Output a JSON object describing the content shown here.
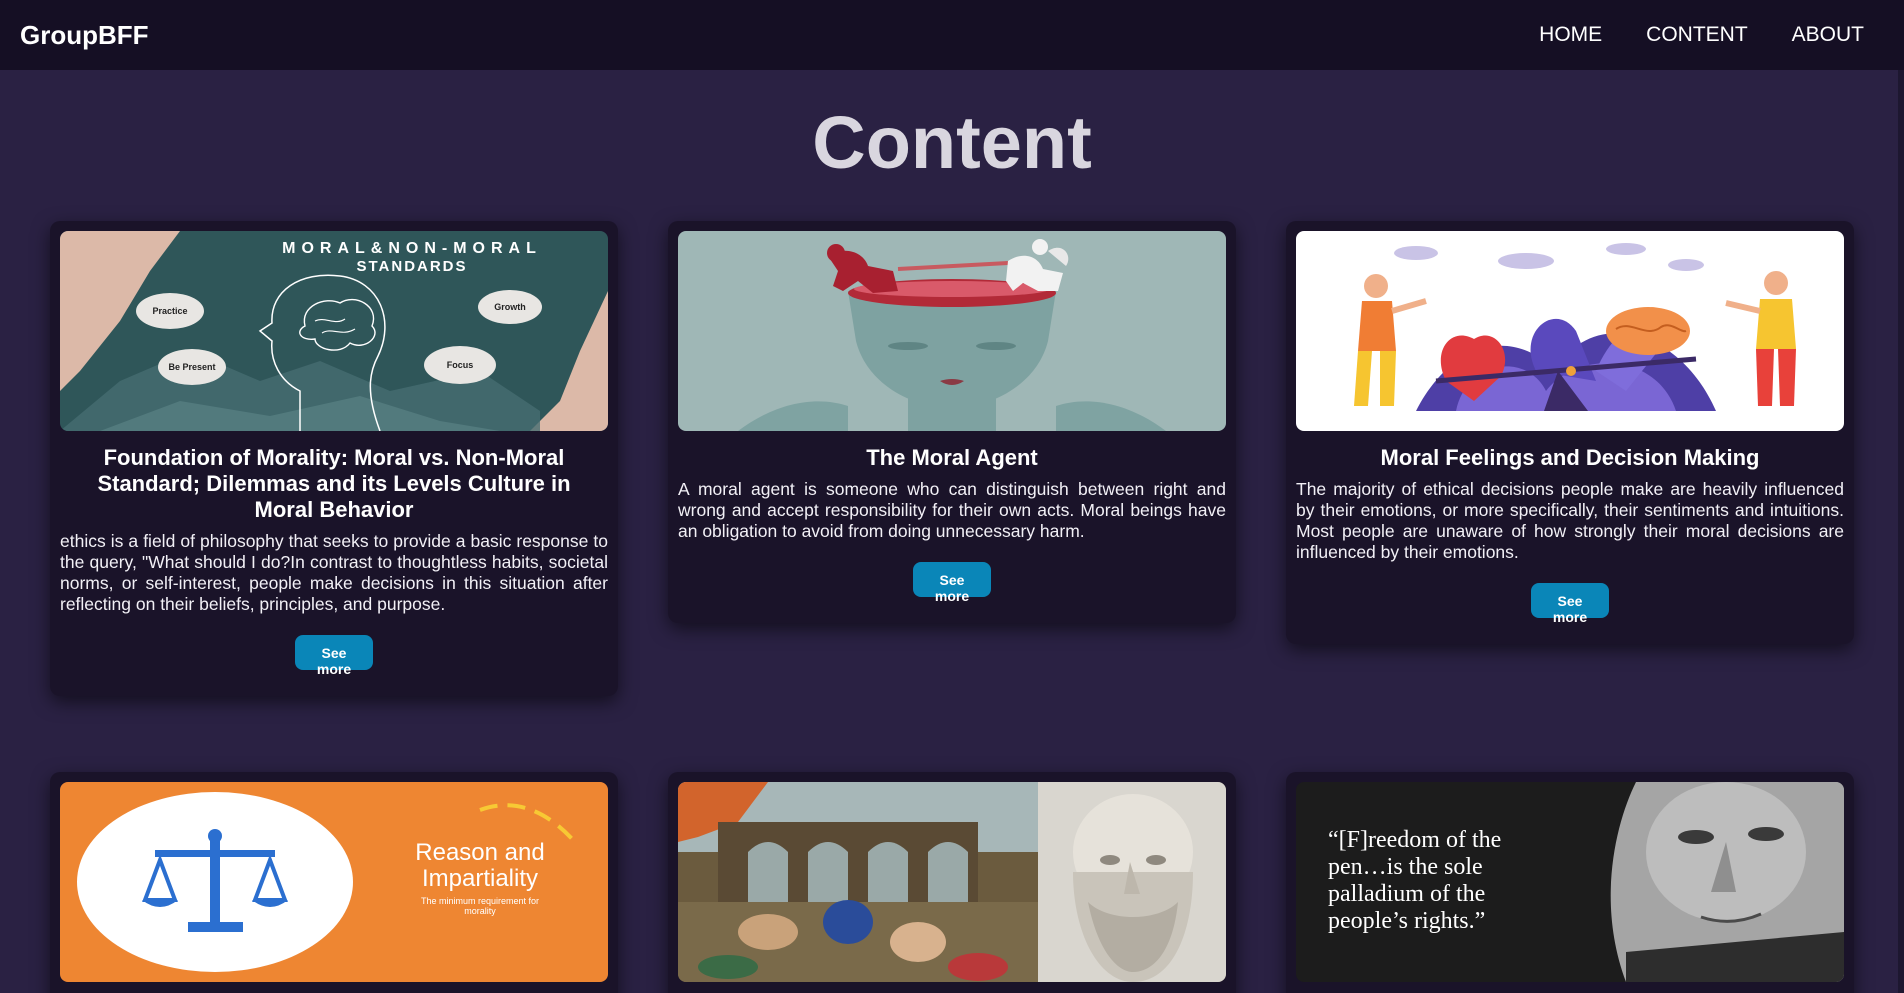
{
  "brand": "GroupBFF",
  "nav": {
    "items": [
      {
        "label": "HOME"
      },
      {
        "label": "CONTENT"
      },
      {
        "label": "ABOUT"
      }
    ]
  },
  "page_title": "Content",
  "cards": [
    {
      "title": "Foundation of Morality: Moral vs. Non-Moral Standard; Dilemmas and its Levels Culture in Moral Behavior",
      "text": "ethics is a field of philosophy that seeks to provide a basic response to the query, \"What should I do?In contrast to thoughtless habits, societal norms, or self-interest, people make decisions in this situation after reflecting on their beliefs, principles, and purpose.",
      "button": "See more",
      "image": {
        "heading_line1": "MORAL&NON-MORAL",
        "heading_line2": "STANDARDS",
        "bubbles": [
          "Practice",
          "Growth",
          "Be Present",
          "Focus"
        ]
      }
    },
    {
      "title": "The Moral Agent",
      "text": "A moral agent is someone who can distinguish between right and wrong and accept responsibility for their own acts. Moral beings have an obligation to avoid from doing unnecessary harm.",
      "button": "See more"
    },
    {
      "title": "Moral Feelings and Decision Making",
      "text": "The majority of ethical decisions people make are heavily influenced by their emotions, or more specifically, their sentiments and intuitions. Most people are unaware of how strongly their moral decisions are influenced by their emotions.",
      "button": "See more"
    },
    {
      "image": {
        "title_line1": "Reason and",
        "title_line2": "Impartiality",
        "subtitle_line1": "The minimum requirement for",
        "subtitle_line2": "morality"
      }
    },
    {},
    {
      "image": {
        "quote_line1": "“[F]reedom of the",
        "quote_line2": "pen…is the sole",
        "quote_line3": "palladium of the",
        "quote_line4": "people’s rights.”"
      }
    }
  ],
  "colors": {
    "background": "#2a2143",
    "navbar": "#150f24",
    "card": "#1a1329",
    "button": "#0a86b8",
    "title": "#d9d6df"
  }
}
